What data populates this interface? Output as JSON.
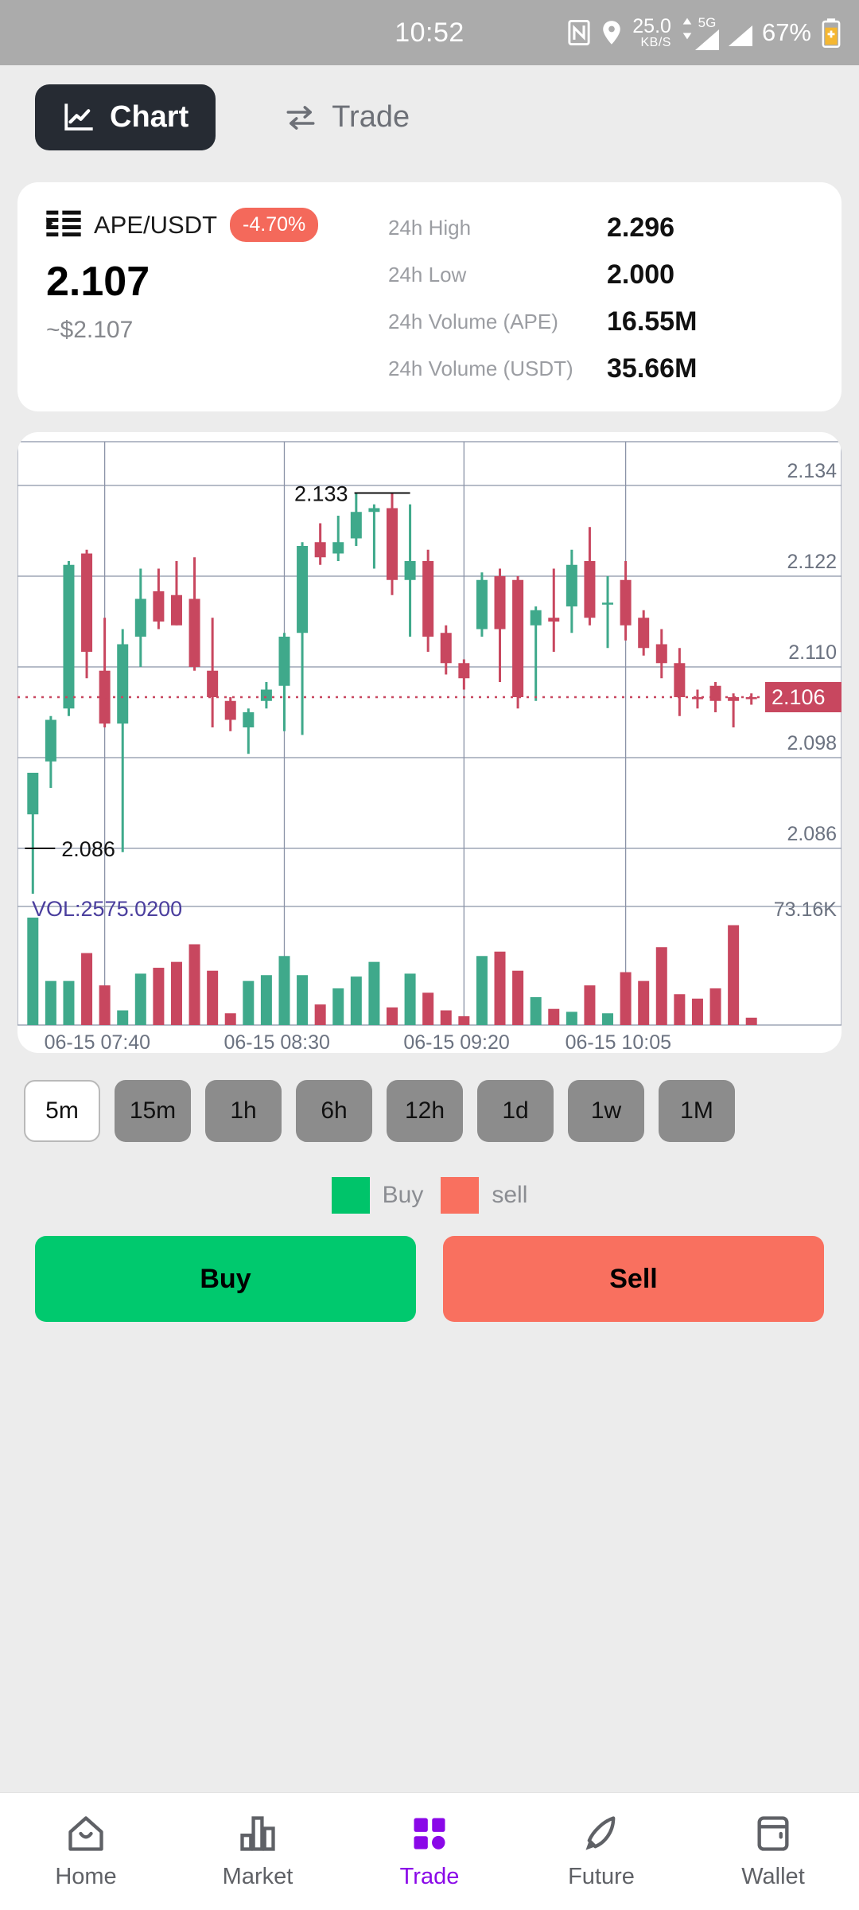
{
  "status_bar": {
    "time": "10:52",
    "nfc_icon": "nfc-icon",
    "location_icon": "location-pin-icon",
    "net_speed_value": "25.0",
    "net_speed_unit": "KB/S",
    "network_type": "5G",
    "battery_percent": "67%",
    "battery_icon": "battery-charging-icon"
  },
  "top_tabs": [
    {
      "label": "Chart",
      "icon": "line-chart-icon",
      "active": true
    },
    {
      "label": "Trade",
      "icon": "swap-arrows-icon",
      "active": false
    }
  ],
  "ticker": {
    "list_icon": "order-list-icon",
    "pair": "APE/USDT",
    "change_percent": "-4.70%",
    "change_color": "#f4695b",
    "price": "2.107",
    "price_usd": "~$2.107",
    "stats": [
      {
        "label": "24h High",
        "value": "2.296"
      },
      {
        "label": "24h Low",
        "value": "2.000"
      },
      {
        "label": "24h Volume (APE)",
        "value": "16.55M"
      },
      {
        "label": "24h Volume (USDT)",
        "value": "35.66M"
      }
    ]
  },
  "chart_data": {
    "type": "candlestick",
    "title": "",
    "xlabel": "",
    "ylabel": "",
    "ylim": [
      2.08,
      2.14
    ],
    "grid": true,
    "y_ticks": [
      "2.134",
      "2.122",
      "2.110",
      "2.098",
      "2.086"
    ],
    "y_tick_values": [
      2.134,
      2.122,
      2.11,
      2.098,
      2.086
    ],
    "x_ticks": [
      "06-15 07:40",
      "06-15 08:30",
      "06-15 09:20",
      "06-15 10:05"
    ],
    "x_tick_index": [
      4,
      14,
      24,
      33
    ],
    "annotations": {
      "high_label": "2.133",
      "high_value": 2.133,
      "high_index": 21,
      "low_label": "2.086",
      "low_value": 2.086,
      "low_index": 0,
      "last_price_tag": "2.106",
      "last_price_value": 2.106,
      "volume_label": "VOL:2575.0200",
      "volume_color": "#4b3f9e",
      "volume_axis_max_label": "73.16K",
      "volume_axis_max": 73160
    },
    "colors": {
      "up": "#3fa98b",
      "down": "#c8475f",
      "grid": "#8b93a7"
    },
    "candles": [
      {
        "o": 2.0905,
        "h": 2.096,
        "l": 2.08,
        "c": 2.096,
        "dir": "up",
        "v": 73160
      },
      {
        "o": 2.0975,
        "h": 2.1035,
        "l": 2.094,
        "c": 2.103,
        "dir": "up",
        "v": 30000
      },
      {
        "o": 2.1045,
        "h": 2.124,
        "l": 2.1035,
        "c": 2.1235,
        "dir": "up",
        "v": 30000
      },
      {
        "o": 2.125,
        "h": 2.1255,
        "l": 2.1085,
        "c": 2.112,
        "dir": "down",
        "v": 49000
      },
      {
        "o": 2.1095,
        "h": 2.1165,
        "l": 2.102,
        "c": 2.1025,
        "dir": "down",
        "v": 27000
      },
      {
        "o": 2.1025,
        "h": 2.115,
        "l": 2.0855,
        "c": 2.113,
        "dir": "up",
        "v": 10000
      },
      {
        "o": 2.114,
        "h": 2.123,
        "l": 2.11,
        "c": 2.119,
        "dir": "up",
        "v": 35000
      },
      {
        "o": 2.12,
        "h": 2.123,
        "l": 2.115,
        "c": 2.116,
        "dir": "down",
        "v": 39000
      },
      {
        "o": 2.1195,
        "h": 2.124,
        "l": 2.1155,
        "c": 2.1155,
        "dir": "down",
        "v": 43000
      },
      {
        "o": 2.119,
        "h": 2.1245,
        "l": 2.1095,
        "c": 2.11,
        "dir": "down",
        "v": 55000
      },
      {
        "o": 2.1095,
        "h": 2.1165,
        "l": 2.102,
        "c": 2.106,
        "dir": "down",
        "v": 37000
      },
      {
        "o": 2.1055,
        "h": 2.106,
        "l": 2.1015,
        "c": 2.103,
        "dir": "down",
        "v": 8000
      },
      {
        "o": 2.104,
        "h": 2.1045,
        "l": 2.0985,
        "c": 2.102,
        "dir": "up",
        "v": 30000
      },
      {
        "o": 2.1055,
        "h": 2.108,
        "l": 2.1045,
        "c": 2.107,
        "dir": "up",
        "v": 34000
      },
      {
        "o": 2.1075,
        "h": 2.1145,
        "l": 2.1015,
        "c": 2.114,
        "dir": "up",
        "v": 47000
      },
      {
        "o": 2.1145,
        "h": 2.1265,
        "l": 2.101,
        "c": 2.126,
        "dir": "up",
        "v": 34000
      },
      {
        "o": 2.1265,
        "h": 2.129,
        "l": 2.1235,
        "c": 2.1245,
        "dir": "down",
        "v": 14000
      },
      {
        "o": 2.125,
        "h": 2.13,
        "l": 2.124,
        "c": 2.1265,
        "dir": "up",
        "v": 25000
      },
      {
        "o": 2.127,
        "h": 2.133,
        "l": 2.126,
        "c": 2.1305,
        "dir": "up",
        "v": 33000
      },
      {
        "o": 2.131,
        "h": 2.1315,
        "l": 2.123,
        "c": 2.1305,
        "dir": "up",
        "v": 43000
      },
      {
        "o": 2.131,
        "h": 2.133,
        "l": 2.1195,
        "c": 2.1215,
        "dir": "down",
        "v": 12000
      },
      {
        "o": 2.1215,
        "h": 2.1315,
        "l": 2.114,
        "c": 2.124,
        "dir": "up",
        "v": 35000
      },
      {
        "o": 2.124,
        "h": 2.1255,
        "l": 2.112,
        "c": 2.114,
        "dir": "down",
        "v": 22000
      },
      {
        "o": 2.1145,
        "h": 2.1155,
        "l": 2.109,
        "c": 2.1105,
        "dir": "down",
        "v": 10000
      },
      {
        "o": 2.1105,
        "h": 2.111,
        "l": 2.107,
        "c": 2.1085,
        "dir": "down",
        "v": 6000
      },
      {
        "o": 2.1215,
        "h": 2.1225,
        "l": 2.114,
        "c": 2.115,
        "dir": "up",
        "v": 47000
      },
      {
        "o": 2.122,
        "h": 2.123,
        "l": 2.108,
        "c": 2.115,
        "dir": "down",
        "v": 50000
      },
      {
        "o": 2.1215,
        "h": 2.122,
        "l": 2.1045,
        "c": 2.106,
        "dir": "down",
        "v": 37000
      },
      {
        "o": 2.1175,
        "h": 2.118,
        "l": 2.1055,
        "c": 2.1155,
        "dir": "up",
        "v": 19000
      },
      {
        "o": 2.116,
        "h": 2.123,
        "l": 2.112,
        "c": 2.1165,
        "dir": "down",
        "v": 11000
      },
      {
        "o": 2.118,
        "h": 2.1255,
        "l": 2.1145,
        "c": 2.1235,
        "dir": "up",
        "v": 9000
      },
      {
        "o": 2.124,
        "h": 2.1285,
        "l": 2.1155,
        "c": 2.1165,
        "dir": "down",
        "v": 27000
      },
      {
        "o": 2.1185,
        "h": 2.122,
        "l": 2.1125,
        "c": 2.1185,
        "dir": "up",
        "v": 8000
      },
      {
        "o": 2.1215,
        "h": 2.124,
        "l": 2.1135,
        "c": 2.1155,
        "dir": "down",
        "v": 36000
      },
      {
        "o": 2.1165,
        "h": 2.1175,
        "l": 2.1115,
        "c": 2.1125,
        "dir": "down",
        "v": 30000
      },
      {
        "o": 2.113,
        "h": 2.115,
        "l": 2.1085,
        "c": 2.1105,
        "dir": "down",
        "v": 53000
      },
      {
        "o": 2.1105,
        "h": 2.1125,
        "l": 2.1035,
        "c": 2.106,
        "dir": "down",
        "v": 21000
      },
      {
        "o": 2.106,
        "h": 2.107,
        "l": 2.1045,
        "c": 2.106,
        "dir": "down",
        "v": 18000
      },
      {
        "o": 2.1075,
        "h": 2.108,
        "l": 2.104,
        "c": 2.1055,
        "dir": "down",
        "v": 25000
      },
      {
        "o": 2.106,
        "h": 2.1065,
        "l": 2.102,
        "c": 2.1055,
        "dir": "down",
        "v": 68000
      },
      {
        "o": 2.106,
        "h": 2.1065,
        "l": 2.105,
        "c": 2.106,
        "dir": "down",
        "v": 5000
      }
    ]
  },
  "timeframes": [
    {
      "label": "5m",
      "selected": true
    },
    {
      "label": "15m",
      "selected": false
    },
    {
      "label": "1h",
      "selected": false
    },
    {
      "label": "6h",
      "selected": false
    },
    {
      "label": "12h",
      "selected": false
    },
    {
      "label": "1d",
      "selected": false
    },
    {
      "label": "1w",
      "selected": false
    },
    {
      "label": "1M",
      "selected": false
    }
  ],
  "legend": [
    {
      "label": "Buy",
      "color": "#00c46a"
    },
    {
      "label": "sell",
      "color": "#f9705f"
    }
  ],
  "actions": {
    "buy_label": "Buy",
    "buy_color": "#00c96e",
    "sell_label": "Sell",
    "sell_color": "#f9705f"
  },
  "bottom_nav": [
    {
      "label": "Home",
      "icon": "home-icon",
      "active": false
    },
    {
      "label": "Market",
      "icon": "bar-chart-icon",
      "active": false
    },
    {
      "label": "Trade",
      "icon": "grid-icon",
      "active": true
    },
    {
      "label": "Future",
      "icon": "rocket-icon",
      "active": false
    },
    {
      "label": "Wallet",
      "icon": "wallet-icon",
      "active": false
    }
  ],
  "theme": {
    "accent": "#8a08e8",
    "dark": "#262b33",
    "page_bg": "#ececec"
  }
}
